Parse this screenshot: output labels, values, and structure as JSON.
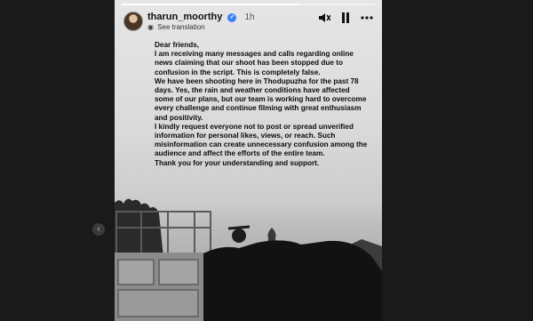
{
  "story": {
    "username": "tharun_moorthy",
    "time": "1h",
    "see_translation": "See translation",
    "progress_fraction": 0.7
  },
  "statement": {
    "lines": [
      "Dear friends,",
      "I am receiving many messages and calls regarding online news claiming that our shoot has been stopped due to confusion in the script. This is completely false.",
      "We have been shooting here in Thodupuzha for the past 78 days. Yes, the rain and weather conditions have affected some of our plans, but our team is working hard to overcome every challenge and continue filming with great enthusiasm and positivity.",
      "I kindly request everyone not to post or spread unverified information for personal likes, views, or reach. Such misinformation can create unnecessary confusion among the audience and affect the efforts of the entire team.",
      "Thank you for your understanding and support."
    ]
  },
  "icons": {
    "mute": "mute-icon",
    "pause": "pause-icon",
    "more": "more-options-icon",
    "prev": "chevron-left-icon",
    "verified": "verified-badge-icon",
    "globe": "globe-icon"
  },
  "colors": {
    "verified": "#3b82f6",
    "background": "#1a1a1a"
  }
}
